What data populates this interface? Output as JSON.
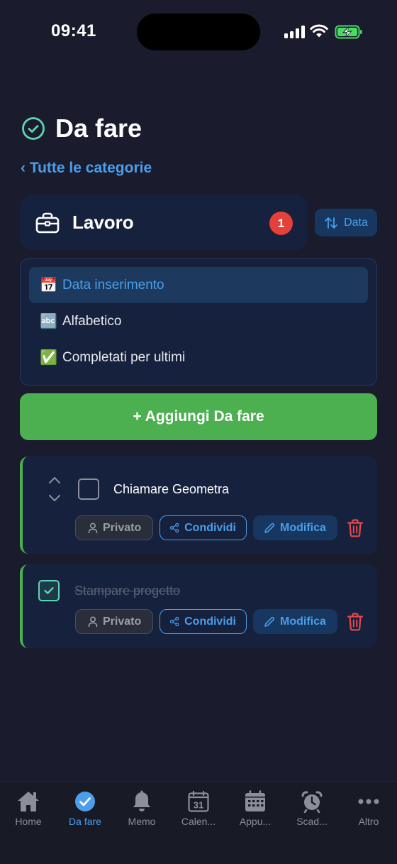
{
  "status_bar": {
    "time": "09:41"
  },
  "header": {
    "title": "Da fare",
    "back_link": "‹ Tutte le categorie"
  },
  "category": {
    "name": "Lavoro",
    "count": "1",
    "icon": "briefcase-icon"
  },
  "sort_button": {
    "label": "Data",
    "icon": "sort-arrows-icon"
  },
  "sort_menu": {
    "options": [
      {
        "emoji": "📅",
        "label": "Data inserimento",
        "active": true
      },
      {
        "emoji": "🔤",
        "label": "Alfabetico",
        "active": false
      },
      {
        "emoji": "✅",
        "label": "Completati per ultimi",
        "active": false
      }
    ]
  },
  "add_button": {
    "label": "+ Aggiungi Da fare"
  },
  "tasks": [
    {
      "title": "Chiamare Geometra",
      "completed": false
    },
    {
      "title": "Stampare progetto",
      "completed": true
    }
  ],
  "task_actions": {
    "private": "Privato",
    "share": "Condividi",
    "edit": "Modifica"
  },
  "tab_bar": {
    "tabs": [
      {
        "label": "Home",
        "icon": "home-icon"
      },
      {
        "label": "Da fare",
        "icon": "check-circle-icon",
        "active": true
      },
      {
        "label": "Memo",
        "icon": "bell-icon"
      },
      {
        "label": "Calen...",
        "icon": "calendar-icon"
      },
      {
        "label": "Appu...",
        "icon": "calendar-grid-icon"
      },
      {
        "label": "Scad...",
        "icon": "alarm-clock-icon"
      },
      {
        "label": "Altro",
        "icon": "more-icon"
      }
    ]
  },
  "colors": {
    "background": "#1a1c2e",
    "card": "#16213e",
    "accent_blue": "#4a9eea",
    "accent_green": "#4caf50",
    "badge_red": "#e5403a",
    "delete_red": "#e5484d"
  }
}
